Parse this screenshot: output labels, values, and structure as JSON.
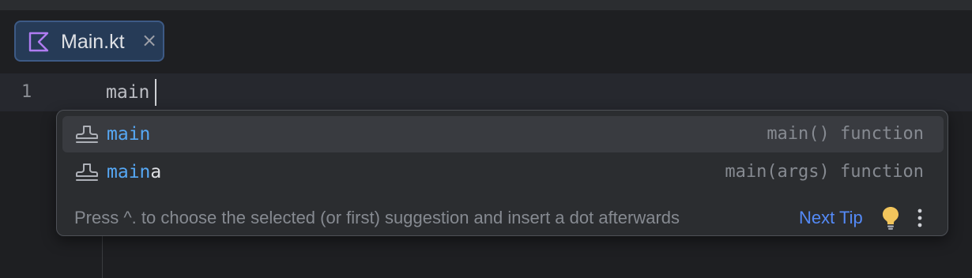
{
  "tab": {
    "label": "Main.kt",
    "icon": "kotlin-file-icon",
    "close_glyph": "×"
  },
  "editor": {
    "line_number": "1",
    "code": "main"
  },
  "completion": {
    "items": [
      {
        "icon": "template-stamp-icon",
        "match": "main",
        "rest": "",
        "type": "main() function",
        "selected": true
      },
      {
        "icon": "template-stamp-icon",
        "match": "main",
        "rest": "a",
        "type": "main(args) function",
        "selected": false
      }
    ],
    "hint": "Press ^. to choose the selected (or first) suggestion and insert a dot afterwards",
    "next_tip": "Next Tip",
    "bulb_icon": "lightbulb-icon",
    "more_icon": "more-vertical-icon"
  },
  "colors": {
    "match": "#56a8f5",
    "link": "#548af7",
    "bulb": "#f2c55c",
    "tab_bg": "#263b57"
  }
}
